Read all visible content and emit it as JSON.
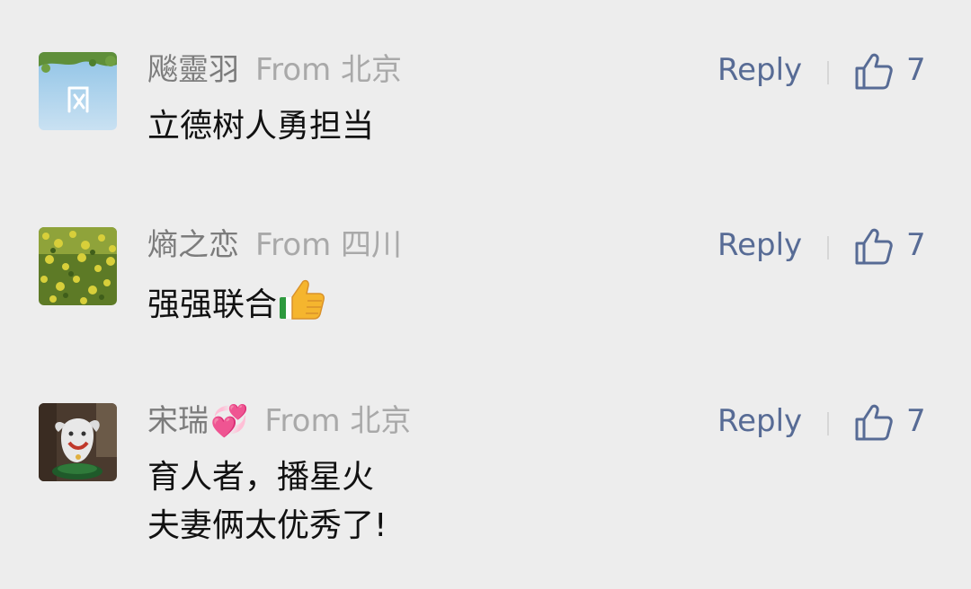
{
  "colors": {
    "background": "#ededed",
    "nickname": "#7c7c7c",
    "location": "#a9a9a9",
    "link": "#576b95",
    "text": "#111111"
  },
  "comments": [
    {
      "nickname": "飚靈羽",
      "location": "From 北京",
      "lines": [
        "立德树人勇担当"
      ],
      "reply_label": "Reply",
      "likes": "7",
      "like_icon": "thumbs-up-outline-icon",
      "avatar": "avatar-sky-leaves"
    },
    {
      "nickname": "熵之恋",
      "location": "From 四川",
      "lines": [
        "强强联合"
      ],
      "emoji": "thumbs-up-emoji",
      "reply_label": "Reply",
      "likes": "7",
      "like_icon": "thumbs-up-outline-icon",
      "avatar": "avatar-rapeseed-field"
    },
    {
      "nickname": "宋瑞",
      "nickname_suffix": "💞",
      "location": "From 北京",
      "lines": [
        "育人者，播星火",
        "夫妻俩太优秀了!"
      ],
      "reply_label": "Reply",
      "likes": "7",
      "like_icon": "thumbs-up-outline-icon",
      "avatar": "avatar-figurine"
    }
  ]
}
